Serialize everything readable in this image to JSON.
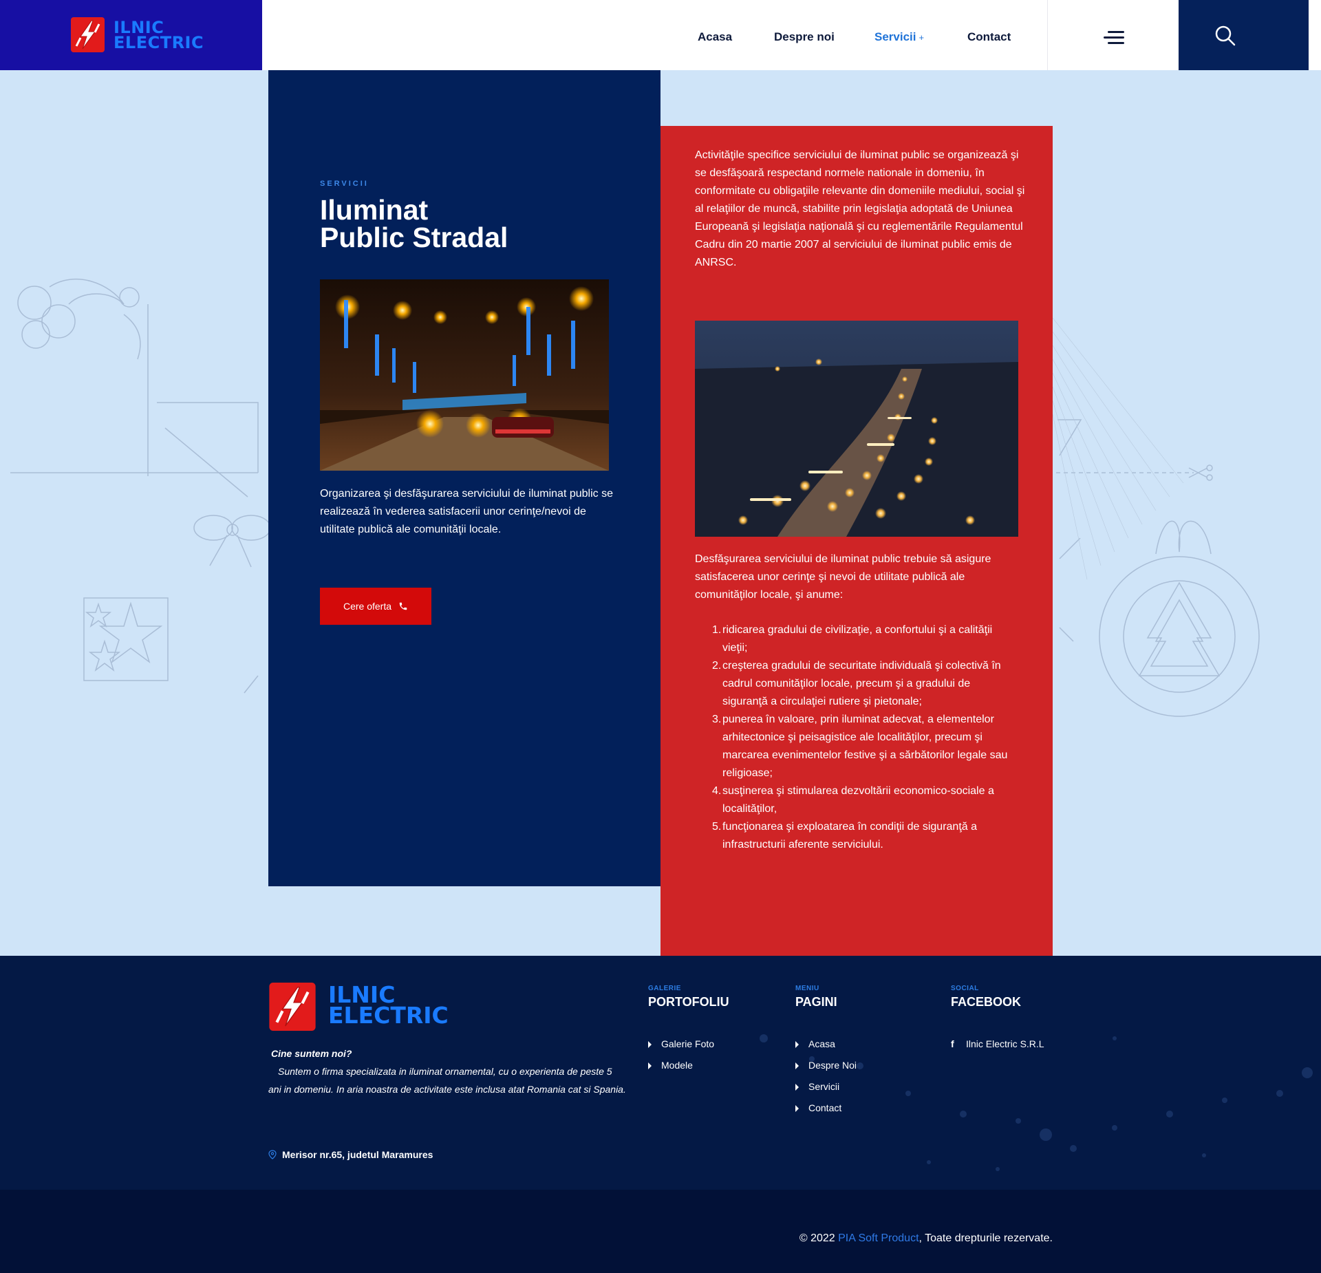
{
  "brand": {
    "line1": "ILNIC",
    "line2": "ELECTRIC"
  },
  "nav": {
    "items": [
      {
        "label": "Acasa"
      },
      {
        "label": "Despre noi"
      },
      {
        "label": "Servicii",
        "suffix": "+"
      },
      {
        "label": "Contact"
      }
    ]
  },
  "hero": {
    "eyebrow": "SERVICII",
    "title_line1": "Iluminat",
    "title_line2": "Public Stradal",
    "intro": "Organizarea şi desfăşurarea serviciului de iluminat public se realizează în vederea satisfacerii unor cerinţe/nevoi de utilitate publică ale comunităţii locale.",
    "cta_label": "Cere oferta"
  },
  "details": {
    "paragraph1": "Activităţile specifice serviciului de iluminat public se organizează şi se desfăşoară respectand normele nationale in domeniu, în conformitate cu obligaţiile relevante din domeniile mediului, social şi al relaţiilor de muncă, stabilite prin legislaţia adoptată de Uniunea Europeană şi legislaţia naţională  şi cu reglementările Regulamentul Cadru din 20 martie 2007 al serviciului de iluminat public emis de ANRSC.",
    "paragraph2": "Desfăşurarea serviciului de iluminat public trebuie să asigure satisfacerea unor cerinţe şi nevoi de utilitate publică ale comunităţilor locale, şi anume:",
    "list": [
      {
        "num": "1.",
        "text": "ridicarea gradului de civilizaţie, a confortului şi a calităţii vieţii;"
      },
      {
        "num": "2.",
        "text": "creşterea gradului de securitate individuală şi colectivă în cadrul comunităţilor locale, precum şi a gradului de siguranţă a circulaţiei rutiere şi pietonale;"
      },
      {
        "num": "3.",
        "text": "punerea în valoare, prin iluminat adecvat, a elementelor arhitectonice şi peisagistice ale localităţilor, precum şi marcarea evenimentelor festive şi a sărbătorilor legale sau religioase;"
      },
      {
        "num": "4.",
        "text": "susţinerea şi stimularea dezvoltării economico-sociale a localităţilor,"
      },
      {
        "num": "5.",
        "text": "funcţionarea şi exploatarea în condiţii de siguranţă a infrastructurii aferente serviciului."
      }
    ]
  },
  "footer": {
    "about_heading": "Cine suntem noi?",
    "about_text": "Suntem o firma specializata in iluminat ornamental, cu o experienta de peste 5 ani in domeniu. In aria noastra de activitate este inclusa atat Romania cat si Spania.",
    "address": "Merisor nr.65, judetul Maramures",
    "columns": [
      {
        "eyebrow": "GALERIE",
        "heading": "PORTOFOLIU",
        "links": [
          "Galerie Foto",
          "Modele"
        ]
      },
      {
        "eyebrow": "MENIU",
        "heading": "PAGINI",
        "links": [
          "Acasa",
          "Despre Noi",
          "Servicii",
          "Contact"
        ]
      },
      {
        "eyebrow": "SOCIAL",
        "heading": "FACEBOOK",
        "links": [
          "Ilnic Electric S.R.L"
        ]
      }
    ],
    "copyright_prefix": "© 2022 ",
    "copyright_link": "PIA Soft Product",
    "copyright_suffix": ", Toate drepturile rezervate."
  },
  "colors": {
    "accent_blue": "#1a7bff",
    "navy": "#02205a",
    "red": "#cf2426",
    "cta_red": "#d30a0a",
    "page_bg": "#cfe4f8"
  }
}
